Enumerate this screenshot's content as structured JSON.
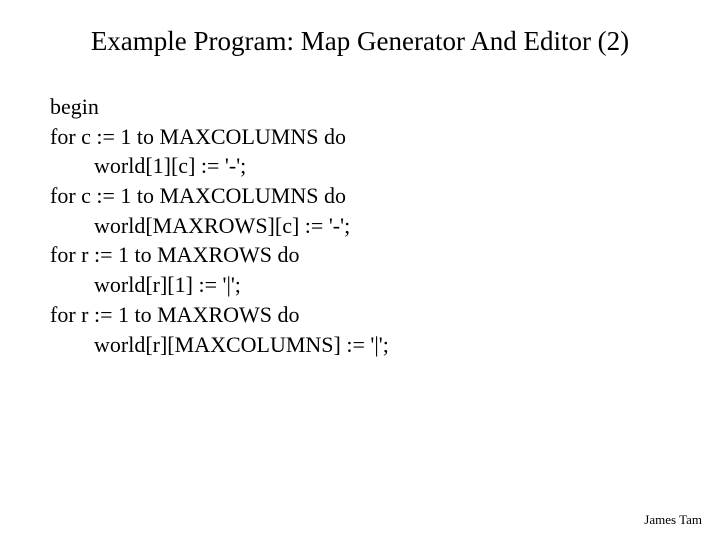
{
  "title": "Example Program: Map Generator And Editor (2)",
  "code": {
    "l1": "begin",
    "l2": "for c := 1 to MAXCOLUMNS do",
    "l3": "world[1][c] := '-';",
    "l4": "for c := 1 to MAXCOLUMNS do",
    "l5": "world[MAXROWS][c] := '-';",
    "l6": "for r := 1 to MAXROWS do",
    "l7": "world[r][1] := '|';",
    "l8": "for r := 1 to MAXROWS do",
    "l9": "world[r][MAXCOLUMNS] := '|';"
  },
  "footer": "James Tam"
}
